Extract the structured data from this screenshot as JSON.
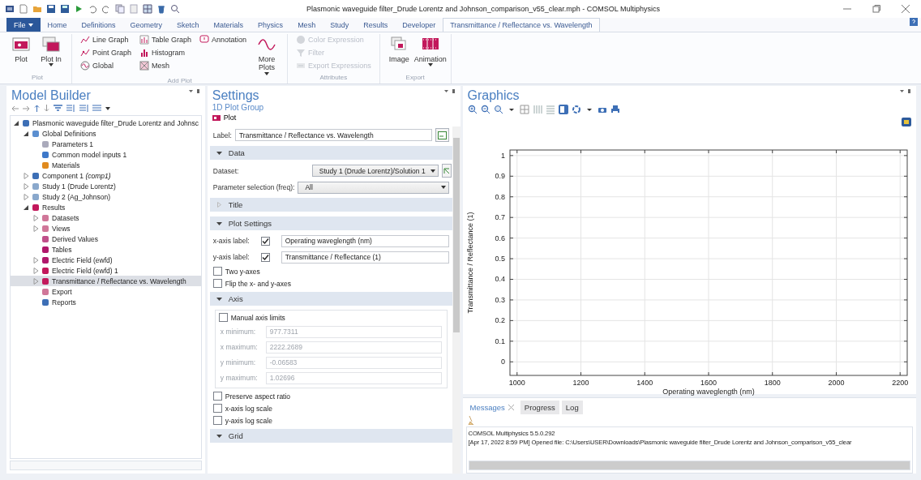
{
  "title_bar": {
    "title": "Plasmonic waveguide filter_Drude Lorentz and Johnson_comparison_v55_clear.mph - COMSOL Multiphysics"
  },
  "ribbon_tabs": [
    {
      "label": "File",
      "kind": "file",
      "selected": false
    },
    {
      "label": "Home",
      "kind": "tab",
      "selected": false
    },
    {
      "label": "Definitions",
      "kind": "tab",
      "selected": false
    },
    {
      "label": "Geometry",
      "kind": "tab",
      "selected": false
    },
    {
      "label": "Sketch",
      "kind": "tab",
      "selected": false
    },
    {
      "label": "Materials",
      "kind": "tab",
      "selected": false
    },
    {
      "label": "Physics",
      "kind": "tab",
      "selected": false
    },
    {
      "label": "Mesh",
      "kind": "tab",
      "selected": false
    },
    {
      "label": "Study",
      "kind": "tab",
      "selected": false
    },
    {
      "label": "Results",
      "kind": "tab",
      "selected": false
    },
    {
      "label": "Developer",
      "kind": "tab",
      "selected": false
    },
    {
      "label": "Transmittance / Reflectance vs. Wavelength",
      "kind": "tab",
      "selected": true
    }
  ],
  "ribbon_groups": [
    {
      "label": "Plot",
      "items": [
        {
          "kind": "large",
          "label": "Plot",
          "dropdown": false,
          "disabled": false
        },
        {
          "kind": "large",
          "label": "Plot In",
          "dropdown": true,
          "disabled": false
        }
      ]
    },
    {
      "label": "Add Plot",
      "items": [
        {
          "kind": "small",
          "label": "Line Graph",
          "disabled": false
        },
        {
          "kind": "small",
          "label": "Point Graph",
          "disabled": false
        },
        {
          "kind": "small",
          "label": "Global",
          "disabled": false
        },
        {
          "kind": "small",
          "label": "Table Graph",
          "disabled": false
        },
        {
          "kind": "small",
          "label": "Histogram",
          "disabled": false
        },
        {
          "kind": "small",
          "label": "Mesh",
          "disabled": false
        },
        {
          "kind": "small",
          "label": "Annotation",
          "disabled": false
        },
        {
          "kind": "large",
          "label": "More Plots",
          "dropdown": true,
          "disabled": false
        }
      ]
    },
    {
      "label": "Attributes",
      "items": [
        {
          "kind": "small",
          "label": "Color Expression",
          "disabled": true
        },
        {
          "kind": "small",
          "label": "Filter",
          "disabled": true
        },
        {
          "kind": "small",
          "label": "Export Expressions",
          "disabled": true
        }
      ]
    },
    {
      "label": "Export",
      "items": [
        {
          "kind": "large",
          "label": "Image",
          "dropdown": false,
          "disabled": false
        },
        {
          "kind": "large",
          "label": "Animation",
          "dropdown": true,
          "disabled": false
        }
      ]
    }
  ],
  "model_builder": {
    "title": "Model Builder",
    "tree": [
      {
        "label": "Plasmonic waveguide filter_Drude Lorentz and Johnsc",
        "expanded": true,
        "selected": false,
        "children": [
          {
            "label": "Global Definitions",
            "expanded": true,
            "selected": false,
            "children": [
              {
                "label": "Parameters 1",
                "selected": false
              },
              {
                "label": "Common model inputs 1",
                "selected": false
              },
              {
                "label": "Materials",
                "selected": false
              }
            ]
          },
          {
            "label": "Component 1 *(comp1)*",
            "expanded": false,
            "selected": false
          },
          {
            "label": "Study 1 (Drude Lorentz)",
            "expanded": false,
            "selected": false
          },
          {
            "label": "Study 2 (Ag_Johnson)",
            "expanded": false,
            "selected": false
          },
          {
            "label": "Results",
            "expanded": true,
            "selected": false,
            "children": [
              {
                "label": "Datasets",
                "expanded": false,
                "selected": false
              },
              {
                "label": "Views",
                "expanded": false,
                "selected": false
              },
              {
                "label": "Derived Values",
                "selected": false
              },
              {
                "label": "Tables",
                "selected": false
              },
              {
                "label": "Electric Field (ewfd)",
                "expanded": false,
                "selected": false
              },
              {
                "label": "Electric Field (ewfd) 1",
                "expanded": false,
                "selected": false
              },
              {
                "label": "Transmittance / Reflectance vs. Wavelength",
                "expanded": false,
                "selected": true
              },
              {
                "label": "Export",
                "selected": false
              },
              {
                "label": "Reports",
                "selected": false
              }
            ]
          }
        ]
      }
    ]
  },
  "settings": {
    "title": "Settings",
    "subtitle": "1D Plot Group",
    "plot_button": "Plot",
    "label_field": {
      "label": "Label:",
      "value": "Transmittance / Reflectance vs. Wavelength"
    },
    "sections": [
      {
        "title": "Data",
        "expanded": true,
        "rows": [
          {
            "kind": "select",
            "label": "Dataset:",
            "value": "Study 1 (Drude Lorentz)/Solution 1"
          },
          {
            "kind": "select",
            "label": "Parameter selection (freq):",
            "value": "All"
          }
        ]
      },
      {
        "title": "Title",
        "expanded": false
      },
      {
        "title": "Plot Settings",
        "expanded": true,
        "rows": [
          {
            "kind": "labeled_check",
            "label": "x-axis label:",
            "checked": true,
            "value": "Operating waveglength (nm)"
          },
          {
            "kind": "labeled_check",
            "label": "y-axis label:",
            "checked": true,
            "value": "Transmittance / Reflectance (1)"
          },
          {
            "kind": "check",
            "label": "Two y-axes",
            "checked": false
          },
          {
            "kind": "check",
            "label": "Flip the x- and y-axes",
            "checked": false
          }
        ]
      },
      {
        "title": "Axis",
        "expanded": true,
        "rows": [
          {
            "kind": "fieldset",
            "label": "Manual axis limits",
            "checked": false,
            "fields": [
              {
                "label": "x minimum:",
                "value": "977.7311"
              },
              {
                "label": "x maximum:",
                "value": "2222.2689"
              },
              {
                "label": "y minimum:",
                "value": "-0.06583"
              },
              {
                "label": "y maximum:",
                "value": "1.02696"
              }
            ]
          },
          {
            "kind": "check",
            "label": "Preserve aspect ratio",
            "checked": false
          },
          {
            "kind": "check",
            "label": "x-axis log scale",
            "checked": false
          },
          {
            "kind": "check",
            "label": "y-axis log scale",
            "checked": false
          }
        ]
      },
      {
        "title": "Grid",
        "expanded": true
      }
    ]
  },
  "graphics": {
    "title": "Graphics",
    "chart_data": {
      "type": "line",
      "grid": true,
      "xlabel": "Operating waveglength (nm)",
      "ylabel": "Transmittance / Reflectance (1)",
      "xlim": [
        977.7311,
        2222.2689
      ],
      "ylim": [
        -0.06583,
        1.02696
      ],
      "xticks": [
        1000,
        1200,
        1400,
        1600,
        1800,
        2000,
        2200
      ],
      "yticks": [
        0,
        0.1,
        0.2,
        0.3,
        0.4,
        0.5,
        0.6,
        0.7,
        0.8,
        0.9,
        1
      ]
    }
  },
  "messages": {
    "tabs": [
      {
        "label": "Messages",
        "selected": true,
        "closable": true
      },
      {
        "label": "Progress",
        "selected": false,
        "closable": false
      },
      {
        "label": "Log",
        "selected": false,
        "closable": false
      }
    ],
    "lines": [
      "COMSOL Multiphysics 5.5.0.292",
      "[Apr 17, 2022 8:59 PM] Opened file: C:\\Users\\USER\\Downloads\\Plasmonic waveguide filter_Drude Lorentz and Johnson_comparison_v55_clear"
    ]
  }
}
